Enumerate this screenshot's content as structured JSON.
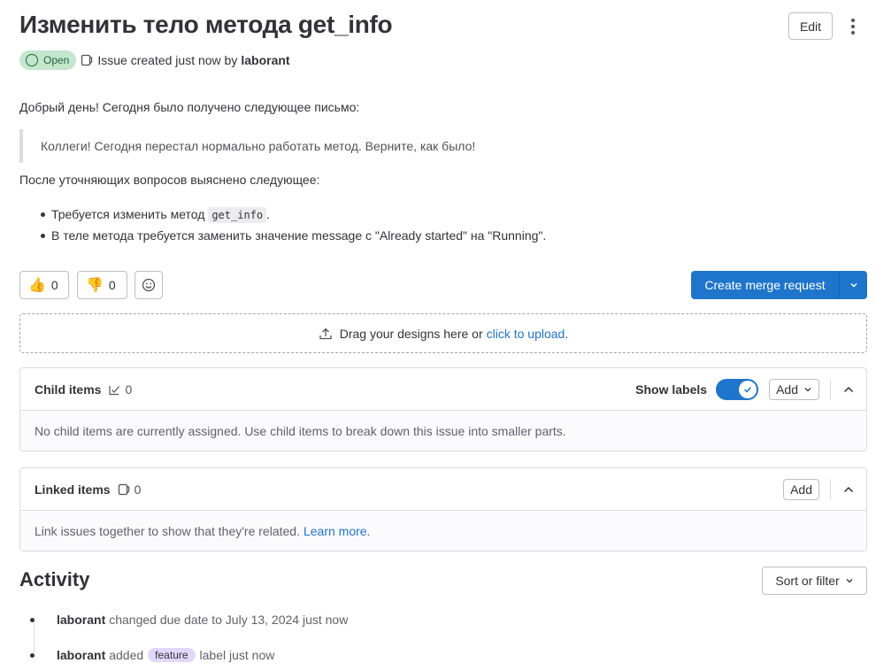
{
  "issue": {
    "title": "Изменить тело метода get_info",
    "status": "Open",
    "meta_text": "Issue created just now by",
    "author": "laborant",
    "edit_label": "Edit"
  },
  "description": {
    "greeting": "Добрый день! Сегодня было получено следующее письмо:",
    "quote": "Коллеги! Сегодня перестал нормально работать метод. Верните, как было!",
    "after_quote": "После уточняющих вопросов выяснено следующее:",
    "bullet1_prefix": "Требуется изменить метод",
    "bullet1_code": "get_info",
    "bullet1_suffix": ".",
    "bullet2": "В теле метода требуется заменить значение message с \"Already started\" на \"Running\"."
  },
  "reactions": {
    "thumbs_up_emoji": "👍",
    "thumbs_up_count": "0",
    "thumbs_down_emoji": "👎",
    "thumbs_down_count": "0"
  },
  "merge_request": {
    "label": "Create merge request"
  },
  "dropzone": {
    "text": "Drag your designs here or",
    "link": "click to upload",
    "suffix": "."
  },
  "child_items": {
    "title": "Child items",
    "count": "0",
    "show_labels": "Show labels",
    "add_label": "Add",
    "empty_text": "No child items are currently assigned. Use child items to break down this issue into smaller parts."
  },
  "linked_items": {
    "title": "Linked items",
    "count": "0",
    "add_label": "Add",
    "empty_text": "Link issues together to show that they're related.",
    "learn_more": "Learn more."
  },
  "activity": {
    "title": "Activity",
    "sort_label": "Sort or filter",
    "items": [
      {
        "user": "laborant",
        "text": "changed due date to July 13, 2024 just now"
      },
      {
        "user": "laborant",
        "text_before": "added",
        "label": "feature",
        "text_after": "label just now"
      }
    ]
  },
  "colors": {
    "primary": "#1f75cb",
    "open_badge_bg": "#c3e6cd",
    "open_badge_text": "#24663b",
    "label_feature_bg": "#e1d8f9"
  }
}
